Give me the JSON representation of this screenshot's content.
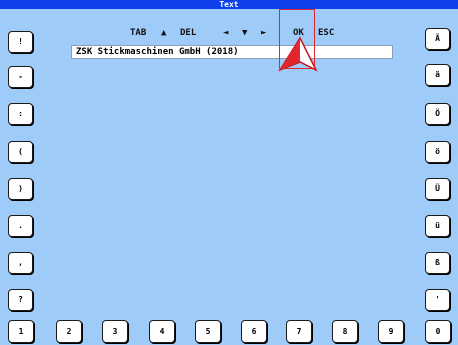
{
  "window": {
    "title": "Text"
  },
  "toolbar": {
    "tab": "TAB",
    "up": "▲",
    "del": "DEL",
    "left": "◄",
    "down": "▼",
    "right": "►",
    "ok": "OK",
    "esc": "ESC"
  },
  "text_field": {
    "value": "ZSK Stickmaschinen GmbH (2018)"
  },
  "keys": {
    "left": [
      "!",
      "-",
      ":",
      "(",
      ")",
      ".",
      ",",
      "?"
    ],
    "right": [
      "Ä",
      "ä",
      "Ö",
      "ö",
      "Ü",
      "ü",
      "ß",
      "'"
    ],
    "bottom": [
      "1",
      "2",
      "3",
      "4",
      "5",
      "6",
      "7",
      "8",
      "9",
      "0"
    ]
  },
  "colors": {
    "background": "#9ecbf7",
    "title_bar": "#0d40ea",
    "highlight": "#e0262e"
  }
}
